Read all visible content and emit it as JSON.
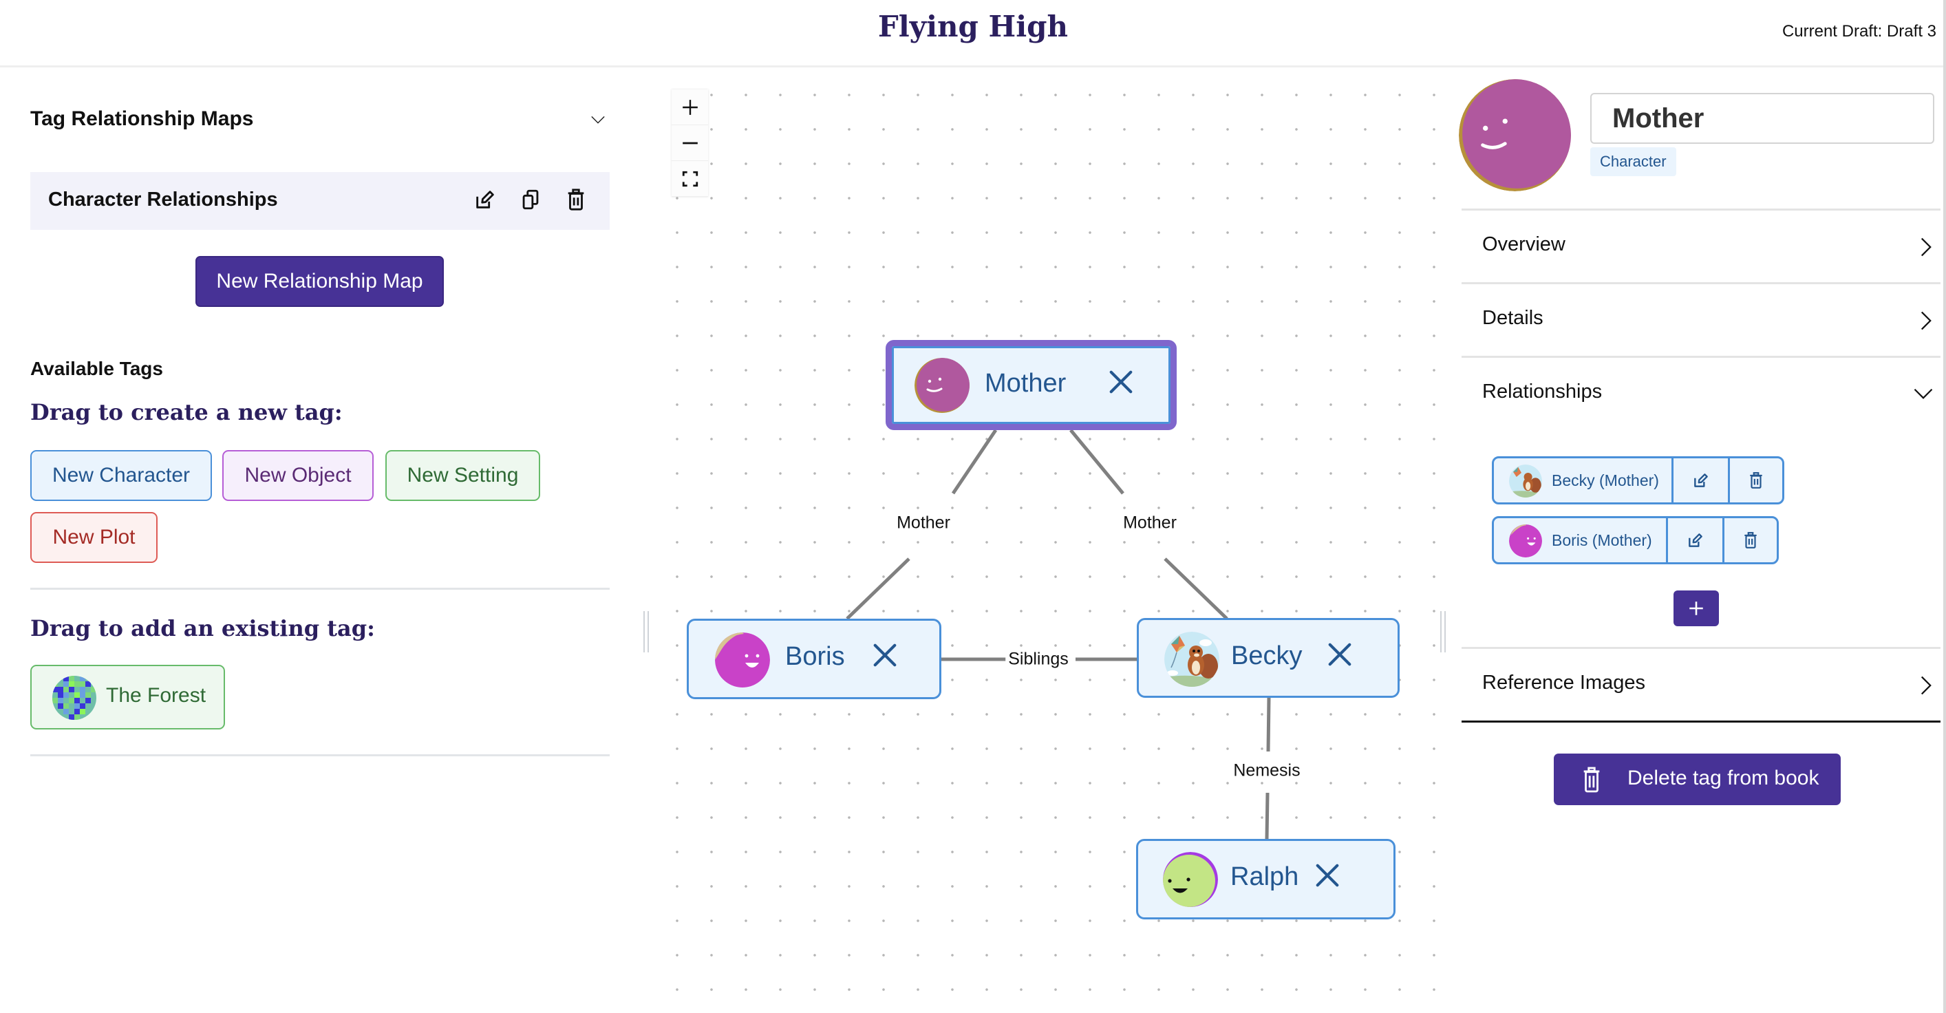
{
  "header": {
    "title": "Flying High",
    "draft_label": "Current Draft: Draft 3"
  },
  "left_panel": {
    "maps_section_title": "Tag Relationship Maps",
    "maps": [
      {
        "label": "Character Relationships",
        "actions": [
          "edit-icon",
          "copy-icon",
          "trash-icon"
        ]
      }
    ],
    "new_map_button": "New Relationship Map",
    "available_tags_title": "Available Tags",
    "create_heading": "Drag to create a new tag:",
    "new_tag_buttons": [
      {
        "label": "New Character",
        "type": "character"
      },
      {
        "label": "New Object",
        "type": "object"
      },
      {
        "label": "New Setting",
        "type": "setting"
      },
      {
        "label": "New Plot",
        "type": "plot"
      }
    ],
    "existing_heading": "Drag to add an existing tag:",
    "existing_tags": [
      {
        "label": "The Forest",
        "type": "setting",
        "avatar": "pixel-pattern"
      }
    ]
  },
  "canvas": {
    "zoom_controls": [
      {
        "name": "zoom-in",
        "icon": "plus-icon"
      },
      {
        "name": "zoom-out",
        "icon": "minus-icon"
      },
      {
        "name": "fit-view",
        "icon": "fullscreen-icon"
      }
    ],
    "nodes": [
      {
        "id": "mother",
        "label": "Mother",
        "selected": true,
        "avatar": "purple-smiley"
      },
      {
        "id": "boris",
        "label": "Boris",
        "selected": false,
        "avatar": "magenta-smiley"
      },
      {
        "id": "becky",
        "label": "Becky",
        "selected": false,
        "avatar": "squirrel-kite"
      },
      {
        "id": "ralph",
        "label": "Ralph",
        "selected": false,
        "avatar": "green-smiley"
      }
    ],
    "edges": [
      {
        "from": "mother",
        "to": "boris",
        "label": "Mother"
      },
      {
        "from": "mother",
        "to": "becky",
        "label": "Mother"
      },
      {
        "from": "boris",
        "to": "becky",
        "label": "Siblings"
      },
      {
        "from": "becky",
        "to": "ralph",
        "label": "Nemesis"
      }
    ]
  },
  "right_panel": {
    "tag_name": "Mother",
    "tag_type": "Character",
    "sections": [
      {
        "label": "Overview",
        "expanded": false
      },
      {
        "label": "Details",
        "expanded": false
      },
      {
        "label": "Relationships",
        "expanded": true
      },
      {
        "label": "Reference Images",
        "expanded": false
      }
    ],
    "relationships": [
      {
        "label": "Becky (Mother)",
        "avatar": "squirrel-kite"
      },
      {
        "label": "Boris (Mother)",
        "avatar": "magenta-smiley"
      }
    ],
    "delete_button": "Delete tag from book"
  },
  "colors": {
    "brand_purple": "#473296",
    "title_navy": "#2b1f5e",
    "selected_border": "#7f66cc",
    "character_blue": "#4a90d9"
  }
}
